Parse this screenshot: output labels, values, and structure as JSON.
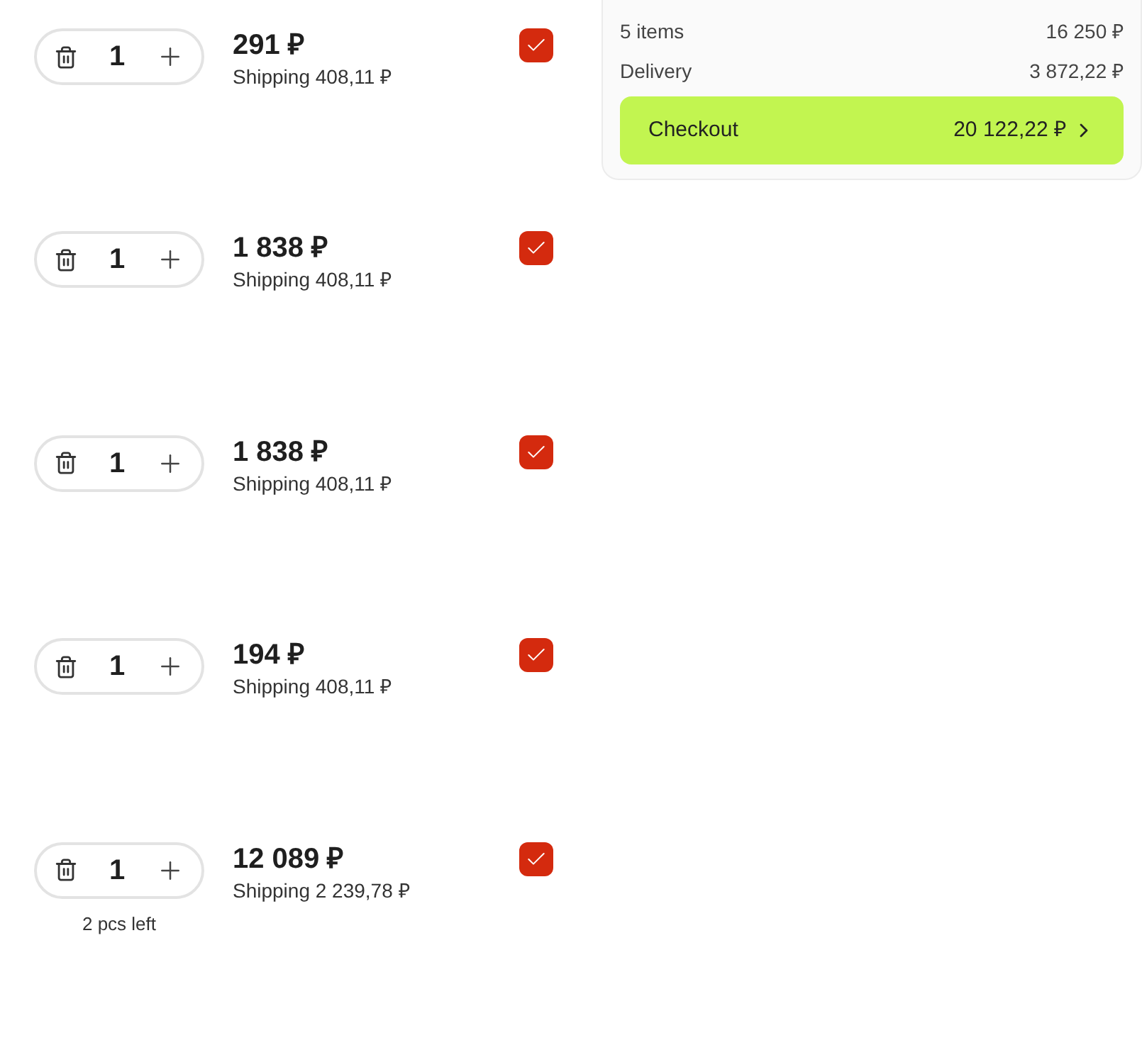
{
  "items": [
    {
      "quantity": "1",
      "price": "291 ₽",
      "shipping": "Shipping 408,11 ₽",
      "checked": true
    },
    {
      "quantity": "1",
      "price": "1 838 ₽",
      "shipping": "Shipping 408,11 ₽",
      "checked": true
    },
    {
      "quantity": "1",
      "price": "1 838 ₽",
      "shipping": "Shipping 408,11 ₽",
      "checked": true
    },
    {
      "quantity": "1",
      "price": "194 ₽",
      "shipping": "Shipping 408,11 ₽",
      "checked": true
    },
    {
      "quantity": "1",
      "price": "12 089 ₽",
      "shipping": "Shipping 2 239,78 ₽",
      "checked": true,
      "stock_note": "2 pcs left"
    }
  ],
  "summary": {
    "rows": [
      {
        "label": "5 items",
        "value": "16 250 ₽"
      },
      {
        "label": "Delivery",
        "value": "3 872,22 ₽"
      }
    ],
    "checkout": {
      "label": "Checkout",
      "total": "20 122,22 ₽"
    }
  }
}
